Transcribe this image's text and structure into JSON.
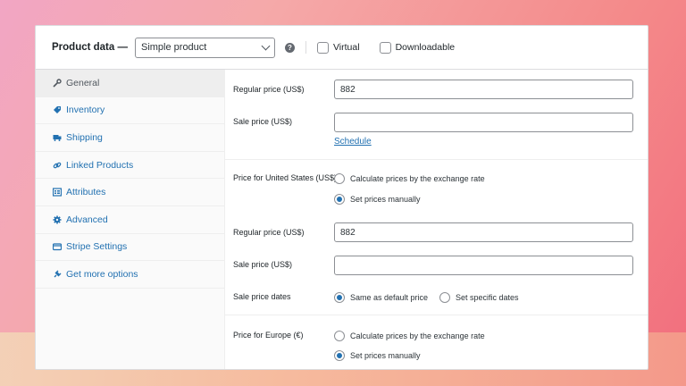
{
  "header": {
    "title": "Product data —",
    "product_type": "Simple product",
    "help_icon": "help-icon",
    "virtual_label": "Virtual",
    "downloadable_label": "Downloadable"
  },
  "sidebar": {
    "items": [
      {
        "label": "General",
        "icon": "wrench-icon",
        "active": true
      },
      {
        "label": "Inventory",
        "icon": "tag-icon",
        "active": false
      },
      {
        "label": "Shipping",
        "icon": "truck-icon",
        "active": false
      },
      {
        "label": "Linked Products",
        "icon": "link-icon",
        "active": false
      },
      {
        "label": "Attributes",
        "icon": "list-icon",
        "active": false
      },
      {
        "label": "Advanced",
        "icon": "gear-icon",
        "active": false
      },
      {
        "label": "Stripe Settings",
        "icon": "card-icon",
        "active": false
      },
      {
        "label": "Get more options",
        "icon": "plugin-icon",
        "active": false
      }
    ]
  },
  "general": {
    "regular_price_label": "Regular price (US$)",
    "regular_price_value": "882",
    "sale_price_label": "Sale price (US$)",
    "sale_price_value": "",
    "schedule_link": "Schedule"
  },
  "us_pricing": {
    "label": "Price for United States (US$)",
    "option_exchange": "Calculate prices by the exchange rate",
    "option_manual": "Set prices manually",
    "selected": "manual",
    "regular_price_label": "Regular price (US$)",
    "regular_price_value": "882",
    "sale_price_label": "Sale price (US$)",
    "sale_price_value": "",
    "sale_dates_label": "Sale price dates",
    "sale_dates_same": "Same as default price",
    "sale_dates_specific": "Set specific dates",
    "sale_dates_selected": "same"
  },
  "eu_pricing": {
    "label": "Price for Europe (€)",
    "option_exchange": "Calculate prices by the exchange rate",
    "option_manual": "Set prices manually",
    "selected": "manual"
  },
  "colors": {
    "accent": "#2271b1",
    "text": "#1d2327"
  }
}
